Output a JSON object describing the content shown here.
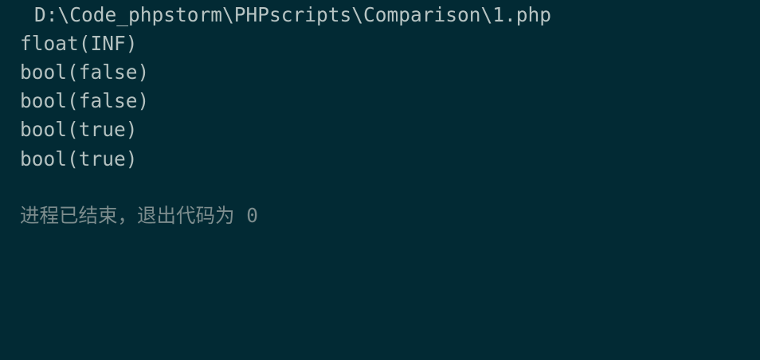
{
  "console": {
    "script_path": "D:\\Code_phpstorm\\PHPscripts\\Comparison\\1.php",
    "output_lines": [
      "float(INF)",
      "bool(false)",
      "bool(false)",
      "bool(true)",
      "bool(true)"
    ],
    "exit_message": "进程已结束，退出代码为 0"
  },
  "colors": {
    "background": "#022a34",
    "output_text": "#b4c1c0",
    "exit_text": "#7d8d8e"
  }
}
